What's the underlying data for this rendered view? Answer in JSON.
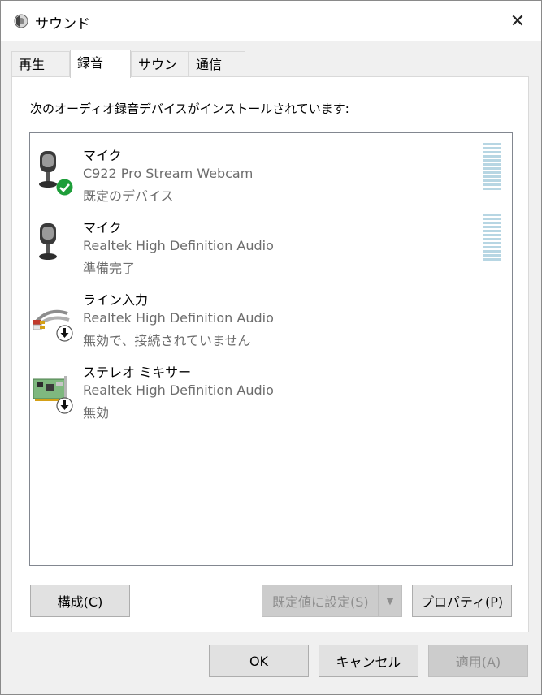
{
  "window": {
    "title": "サウンド",
    "close_glyph": "✕"
  },
  "tabs": [
    {
      "label": "再生",
      "active": false
    },
    {
      "label": "録音",
      "active": true
    },
    {
      "label": "サウンド",
      "active": false
    },
    {
      "label": "通信",
      "active": false
    }
  ],
  "panel": {
    "description": "次のオーディオ録音デバイスがインストールされています:"
  },
  "devices": [
    {
      "name": "マイク",
      "device": "C922 Pro Stream Webcam",
      "status": "既定のデバイス",
      "icon": "microphone-icon",
      "badge": "default-check-icon"
    },
    {
      "name": "マイク",
      "device": "Realtek High Definition Audio",
      "status": "準備完了",
      "icon": "microphone-icon",
      "badge": ""
    },
    {
      "name": "ライン入力",
      "device": "Realtek High Definition Audio",
      "status": "無効で、接続されていません",
      "icon": "line-in-cable-icon",
      "badge": "disabled-arrow-icon"
    },
    {
      "name": "ステレオ ミキサー",
      "device": "Realtek High Definition Audio",
      "status": "無効",
      "icon": "sound-card-icon",
      "badge": "disabled-arrow-icon"
    }
  ],
  "buttons": {
    "configure": "構成(C)",
    "set_default": "既定値に設定(S)",
    "properties": "プロパティ(P)",
    "ok": "OK",
    "cancel": "キャンセル",
    "apply": "適用(A)"
  },
  "colors": {
    "check_green": "#1e9e3a",
    "meter_blue": "#b7d6e3"
  }
}
